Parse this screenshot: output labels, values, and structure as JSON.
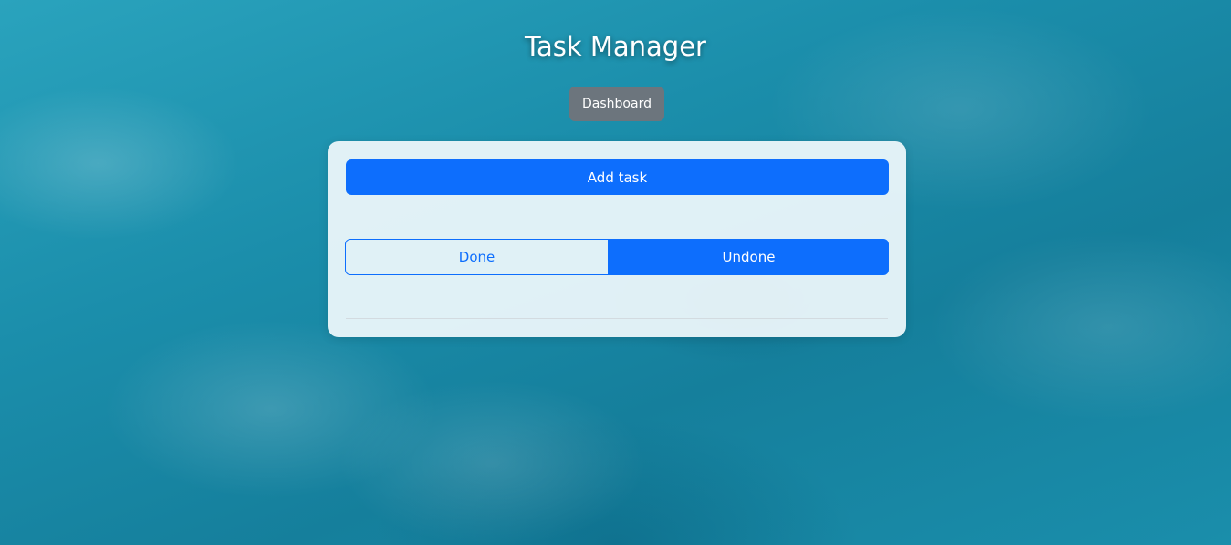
{
  "header": {
    "title": "Task Manager",
    "dashboard_label": "Dashboard"
  },
  "card": {
    "add_task_label": "Add task",
    "filter": {
      "options": [
        "Done",
        "Undone"
      ],
      "done_label": "Done",
      "undone_label": "Undone",
      "selected": "Undone"
    }
  },
  "colors": {
    "primary": "#0d6efd",
    "secondary": "#6c757d",
    "card_background": "#f0f9fc"
  }
}
